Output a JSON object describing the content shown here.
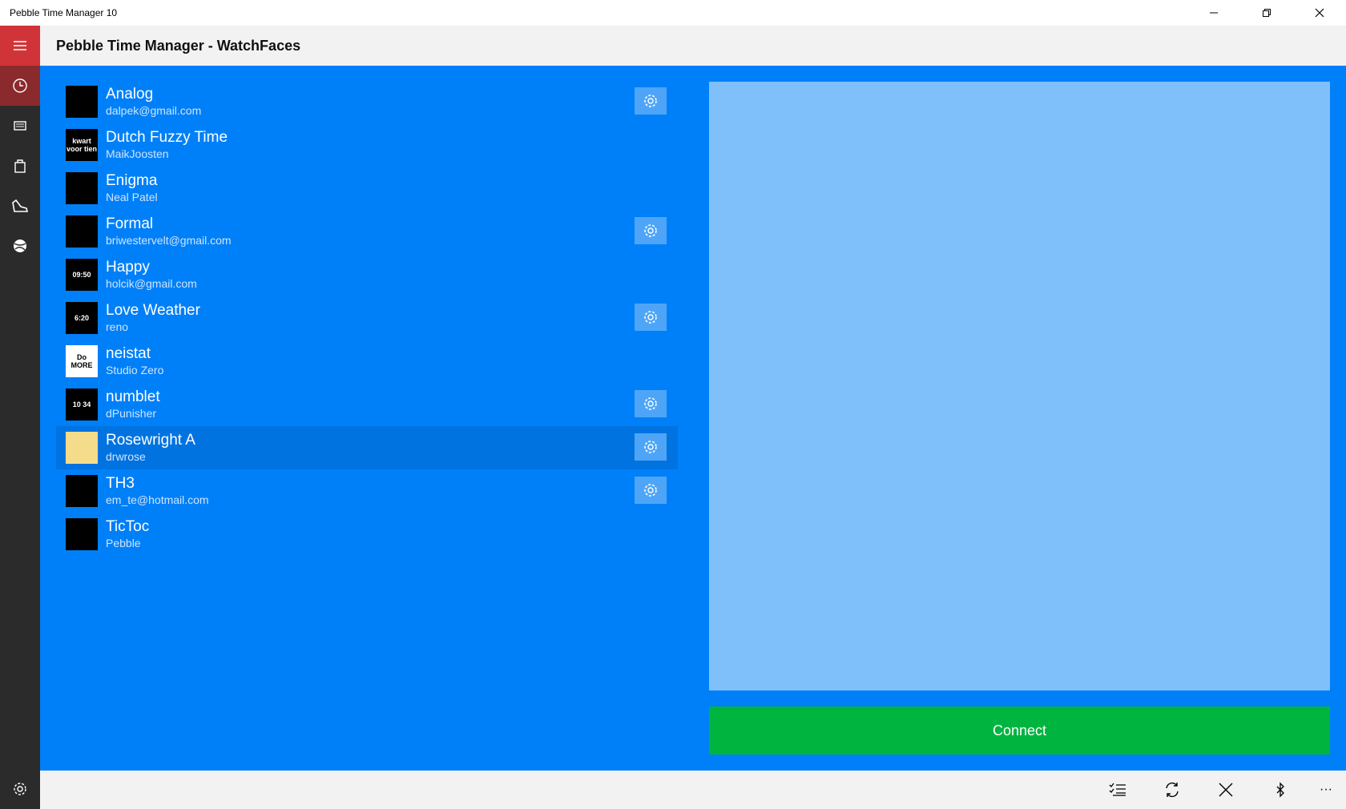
{
  "window": {
    "title": "Pebble Time Manager 10"
  },
  "header": {
    "title": "Pebble Time Manager - WatchFaces"
  },
  "rail": {
    "items": [
      {
        "icon": "clock-icon"
      },
      {
        "icon": "watch-icon"
      },
      {
        "icon": "store-icon"
      },
      {
        "icon": "sneaker-icon"
      },
      {
        "icon": "ball-icon"
      }
    ],
    "settings_icon": "settings-icon"
  },
  "watchfaces": [
    {
      "name": "Analog",
      "author": "dalpek@gmail.com",
      "configurable": true,
      "thumb_text": ""
    },
    {
      "name": "Dutch Fuzzy Time",
      "author": "MaikJoosten",
      "configurable": false,
      "thumb_text": "kwart voor tien"
    },
    {
      "name": "Enigma",
      "author": "Neal Patel",
      "configurable": false,
      "thumb_text": ""
    },
    {
      "name": "Formal",
      "author": "briwestervelt@gmail.com",
      "configurable": true,
      "thumb_text": ""
    },
    {
      "name": "Happy",
      "author": "holcik@gmail.com",
      "configurable": false,
      "thumb_text": "09:50"
    },
    {
      "name": "Love Weather",
      "author": "reno",
      "configurable": true,
      "thumb_text": "6:20"
    },
    {
      "name": "neistat",
      "author": "Studio Zero",
      "configurable": false,
      "thumb_text": "Do MORE"
    },
    {
      "name": "numblet",
      "author": "dPunisher",
      "configurable": true,
      "thumb_text": "10 34"
    },
    {
      "name": "Rosewright A",
      "author": "drwrose",
      "configurable": true,
      "thumb_text": "",
      "selected": true
    },
    {
      "name": "TH3",
      "author": "em_te@hotmail.com",
      "configurable": true,
      "thumb_text": ""
    },
    {
      "name": "TicToc",
      "author": "Pebble",
      "configurable": false,
      "thumb_text": ""
    }
  ],
  "connect_label": "Connect",
  "appbar": {
    "buttons": [
      "select-list-icon",
      "sync-icon",
      "close-icon",
      "bluetooth-icon",
      "more-icon"
    ],
    "more_label": "···"
  },
  "colors": {
    "accent": "#0080f8",
    "rail": "#2b2b2b",
    "hamburger": "#d13438",
    "connect": "#00b53f",
    "preview": "#7fc0fb"
  }
}
